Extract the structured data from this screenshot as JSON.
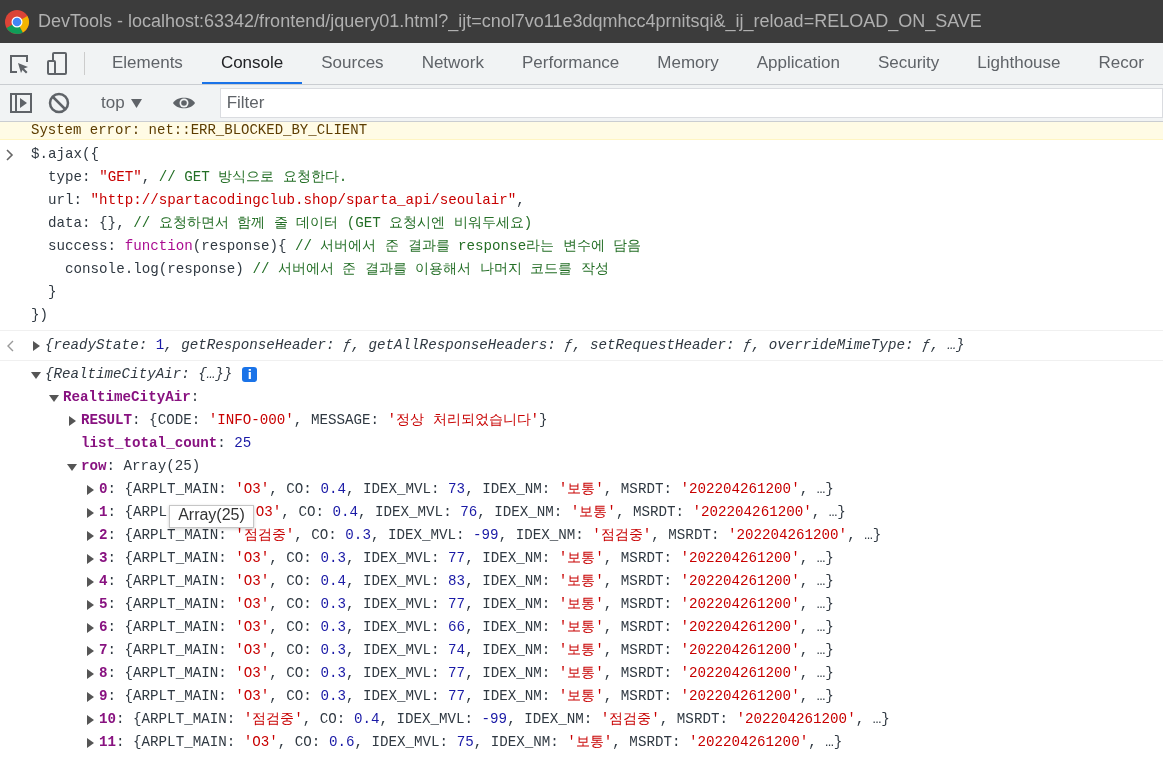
{
  "window": {
    "title": "DevTools - localhost:63342/frontend/jquery01.html?_ijt=cnol7vo11e3dqmhcc4prnitsqi&_ij_reload=RELOAD_ON_SAVE"
  },
  "tabs": [
    {
      "label": "Elements",
      "selected": false
    },
    {
      "label": "Console",
      "selected": true
    },
    {
      "label": "Sources",
      "selected": false
    },
    {
      "label": "Network",
      "selected": false
    },
    {
      "label": "Performance",
      "selected": false
    },
    {
      "label": "Memory",
      "selected": false
    },
    {
      "label": "Application",
      "selected": false
    },
    {
      "label": "Security",
      "selected": false
    },
    {
      "label": "Lighthouse",
      "selected": false
    },
    {
      "label": "Recor",
      "selected": false
    }
  ],
  "console_toolbar": {
    "context": "top",
    "filter": {
      "placeholder": "Filter"
    }
  },
  "error_line": "System error: net::ERR_BLOCKED_BY_CLIENT",
  "input": {
    "lines": [
      [
        {
          "text": "$.ajax({",
          "kind": "plain"
        }
      ],
      [
        {
          "text": "  type: ",
          "kind": "plain"
        },
        {
          "text": "\"GET\"",
          "kind": "string"
        },
        {
          "text": ", ",
          "kind": "plain"
        },
        {
          "text": "// GET 방식으로 요청한다.",
          "kind": "comment"
        }
      ],
      [
        {
          "text": "  url: ",
          "kind": "plain"
        },
        {
          "text": "\"http://spartacodingclub.shop/sparta_api/seoulair\"",
          "kind": "string"
        },
        {
          "text": ",",
          "kind": "plain"
        }
      ],
      [
        {
          "text": "  data: {}, ",
          "kind": "plain"
        },
        {
          "text": "// 요청하면서 함께 줄 데이터 (GET 요청시엔 비워두세요)",
          "kind": "comment"
        }
      ],
      [
        {
          "text": "  success: ",
          "kind": "plain"
        },
        {
          "text": "function",
          "kind": "keyword"
        },
        {
          "text": "(response){ ",
          "kind": "plain"
        },
        {
          "text": "// 서버에서 준 결과를 response라는 변수에 담음",
          "kind": "comment"
        }
      ],
      [
        {
          "text": "    console.log(response) ",
          "kind": "plain"
        },
        {
          "text": "// 서버에서 준 결과를 이용해서 나머지 코드를 작성",
          "kind": "comment"
        }
      ],
      [
        {
          "text": "  }",
          "kind": "plain"
        }
      ],
      [
        {
          "text": "})",
          "kind": "plain"
        }
      ]
    ]
  },
  "result": {
    "expanded": false,
    "tokens": [
      {
        "text": "{readyState: ",
        "kind": "preview"
      },
      {
        "text": "1",
        "kind": "number"
      },
      {
        "text": ", getResponseHeader: ƒ, getAllResponseHeaders: ƒ, setRequestHeader: ƒ, overrideMimeType: ƒ, …}",
        "kind": "preview"
      }
    ]
  },
  "tree": {
    "expanded": true,
    "info": "i",
    "tokens": [
      {
        "text": "{RealtimeCityAir: {…}}",
        "kind": "preview"
      }
    ],
    "children": [
      {
        "expanded": true,
        "tokens": [
          {
            "text": "RealtimeCityAir",
            "kind": "key"
          },
          {
            "text": ":",
            "kind": "plain"
          }
        ],
        "children": [
          {
            "expanded": false,
            "tokens": [
              {
                "text": "RESULT",
                "kind": "key"
              },
              {
                "text": ": {CODE: ",
                "kind": "plain"
              },
              {
                "text": "'INFO-000'",
                "kind": "string"
              },
              {
                "text": ", MESSAGE: ",
                "kind": "plain"
              },
              {
                "text": "'정상 처리되었습니다'",
                "kind": "string"
              },
              {
                "text": "}",
                "kind": "plain"
              }
            ]
          },
          {
            "tokens": [
              {
                "text": "list_total_count",
                "kind": "key"
              },
              {
                "text": ": ",
                "kind": "plain"
              },
              {
                "text": "25",
                "kind": "number"
              }
            ]
          },
          {
            "expanded": true,
            "tokens": [
              {
                "text": "row",
                "kind": "key"
              },
              {
                "text": ": Array(25)",
                "kind": "plain"
              }
            ],
            "children": [
              {
                "expanded": false,
                "tokens": [
                  {
                    "text": "0",
                    "kind": "key"
                  },
                  {
                    "text": ": {ARPLT_MAIN: ",
                    "kind": "plain"
                  },
                  {
                    "text": "'O3'",
                    "kind": "string"
                  },
                  {
                    "text": ", CO: ",
                    "kind": "plain"
                  },
                  {
                    "text": "0.4",
                    "kind": "number"
                  },
                  {
                    "text": ", IDEX_MVL: ",
                    "kind": "plain"
                  },
                  {
                    "text": "73",
                    "kind": "number"
                  },
                  {
                    "text": ", IDEX_NM: ",
                    "kind": "plain"
                  },
                  {
                    "text": "'보통'",
                    "kind": "string"
                  },
                  {
                    "text": ", MSRDT: ",
                    "kind": "plain"
                  },
                  {
                    "text": "'202204261200'",
                    "kind": "string"
                  },
                  {
                    "text": ", …}",
                    "kind": "plain"
                  }
                ]
              },
              {
                "expanded": false,
                "tokens": [
                  {
                    "text": "1",
                    "kind": "key"
                  },
                  {
                    "text": ": {ARPL",
                    "kind": "plain"
                  },
                  {
                    "text": "Array(25)",
                    "kind": "tooltip"
                  },
                  {
                    "text": "O3'",
                    "kind": "string"
                  },
                  {
                    "text": ", CO: ",
                    "kind": "plain"
                  },
                  {
                    "text": "0.4",
                    "kind": "number"
                  },
                  {
                    "text": ", IDEX_MVL: ",
                    "kind": "plain"
                  },
                  {
                    "text": "76",
                    "kind": "number"
                  },
                  {
                    "text": ", IDEX_NM: ",
                    "kind": "plain"
                  },
                  {
                    "text": "'보통'",
                    "kind": "string"
                  },
                  {
                    "text": ", MSRDT: ",
                    "kind": "plain"
                  },
                  {
                    "text": "'202204261200'",
                    "kind": "string"
                  },
                  {
                    "text": ", …}",
                    "kind": "plain"
                  }
                ]
              },
              {
                "expanded": false,
                "tokens": [
                  {
                    "text": "2",
                    "kind": "key"
                  },
                  {
                    "text": ": {ARPLT_MAIN: ",
                    "kind": "plain"
                  },
                  {
                    "text": "'점검중'",
                    "kind": "string"
                  },
                  {
                    "text": ", CO: ",
                    "kind": "plain"
                  },
                  {
                    "text": "0.3",
                    "kind": "number"
                  },
                  {
                    "text": ", IDEX_MVL: ",
                    "kind": "plain"
                  },
                  {
                    "text": "-99",
                    "kind": "number"
                  },
                  {
                    "text": ", IDEX_NM: ",
                    "kind": "plain"
                  },
                  {
                    "text": "'점검중'",
                    "kind": "string"
                  },
                  {
                    "text": ", MSRDT: ",
                    "kind": "plain"
                  },
                  {
                    "text": "'202204261200'",
                    "kind": "string"
                  },
                  {
                    "text": ", …}",
                    "kind": "plain"
                  }
                ]
              },
              {
                "expanded": false,
                "tokens": [
                  {
                    "text": "3",
                    "kind": "key"
                  },
                  {
                    "text": ": {ARPLT_MAIN: ",
                    "kind": "plain"
                  },
                  {
                    "text": "'O3'",
                    "kind": "string"
                  },
                  {
                    "text": ", CO: ",
                    "kind": "plain"
                  },
                  {
                    "text": "0.3",
                    "kind": "number"
                  },
                  {
                    "text": ", IDEX_MVL: ",
                    "kind": "plain"
                  },
                  {
                    "text": "77",
                    "kind": "number"
                  },
                  {
                    "text": ", IDEX_NM: ",
                    "kind": "plain"
                  },
                  {
                    "text": "'보통'",
                    "kind": "string"
                  },
                  {
                    "text": ", MSRDT: ",
                    "kind": "plain"
                  },
                  {
                    "text": "'202204261200'",
                    "kind": "string"
                  },
                  {
                    "text": ", …}",
                    "kind": "plain"
                  }
                ]
              },
              {
                "expanded": false,
                "tokens": [
                  {
                    "text": "4",
                    "kind": "key"
                  },
                  {
                    "text": ": {ARPLT_MAIN: ",
                    "kind": "plain"
                  },
                  {
                    "text": "'O3'",
                    "kind": "string"
                  },
                  {
                    "text": ", CO: ",
                    "kind": "plain"
                  },
                  {
                    "text": "0.4",
                    "kind": "number"
                  },
                  {
                    "text": ", IDEX_MVL: ",
                    "kind": "plain"
                  },
                  {
                    "text": "83",
                    "kind": "number"
                  },
                  {
                    "text": ", IDEX_NM: ",
                    "kind": "plain"
                  },
                  {
                    "text": "'보통'",
                    "kind": "string"
                  },
                  {
                    "text": ", MSRDT: ",
                    "kind": "plain"
                  },
                  {
                    "text": "'202204261200'",
                    "kind": "string"
                  },
                  {
                    "text": ", …}",
                    "kind": "plain"
                  }
                ]
              },
              {
                "expanded": false,
                "tokens": [
                  {
                    "text": "5",
                    "kind": "key"
                  },
                  {
                    "text": ": {ARPLT_MAIN: ",
                    "kind": "plain"
                  },
                  {
                    "text": "'O3'",
                    "kind": "string"
                  },
                  {
                    "text": ", CO: ",
                    "kind": "plain"
                  },
                  {
                    "text": "0.3",
                    "kind": "number"
                  },
                  {
                    "text": ", IDEX_MVL: ",
                    "kind": "plain"
                  },
                  {
                    "text": "77",
                    "kind": "number"
                  },
                  {
                    "text": ", IDEX_NM: ",
                    "kind": "plain"
                  },
                  {
                    "text": "'보통'",
                    "kind": "string"
                  },
                  {
                    "text": ", MSRDT: ",
                    "kind": "plain"
                  },
                  {
                    "text": "'202204261200'",
                    "kind": "string"
                  },
                  {
                    "text": ", …}",
                    "kind": "plain"
                  }
                ]
              },
              {
                "expanded": false,
                "tokens": [
                  {
                    "text": "6",
                    "kind": "key"
                  },
                  {
                    "text": ": {ARPLT_MAIN: ",
                    "kind": "plain"
                  },
                  {
                    "text": "'O3'",
                    "kind": "string"
                  },
                  {
                    "text": ", CO: ",
                    "kind": "plain"
                  },
                  {
                    "text": "0.3",
                    "kind": "number"
                  },
                  {
                    "text": ", IDEX_MVL: ",
                    "kind": "plain"
                  },
                  {
                    "text": "66",
                    "kind": "number"
                  },
                  {
                    "text": ", IDEX_NM: ",
                    "kind": "plain"
                  },
                  {
                    "text": "'보통'",
                    "kind": "string"
                  },
                  {
                    "text": ", MSRDT: ",
                    "kind": "plain"
                  },
                  {
                    "text": "'202204261200'",
                    "kind": "string"
                  },
                  {
                    "text": ", …}",
                    "kind": "plain"
                  }
                ]
              },
              {
                "expanded": false,
                "tokens": [
                  {
                    "text": "7",
                    "kind": "key"
                  },
                  {
                    "text": ": {ARPLT_MAIN: ",
                    "kind": "plain"
                  },
                  {
                    "text": "'O3'",
                    "kind": "string"
                  },
                  {
                    "text": ", CO: ",
                    "kind": "plain"
                  },
                  {
                    "text": "0.3",
                    "kind": "number"
                  },
                  {
                    "text": ", IDEX_MVL: ",
                    "kind": "plain"
                  },
                  {
                    "text": "74",
                    "kind": "number"
                  },
                  {
                    "text": ", IDEX_NM: ",
                    "kind": "plain"
                  },
                  {
                    "text": "'보통'",
                    "kind": "string"
                  },
                  {
                    "text": ", MSRDT: ",
                    "kind": "plain"
                  },
                  {
                    "text": "'202204261200'",
                    "kind": "string"
                  },
                  {
                    "text": ", …}",
                    "kind": "plain"
                  }
                ]
              },
              {
                "expanded": false,
                "tokens": [
                  {
                    "text": "8",
                    "kind": "key"
                  },
                  {
                    "text": ": {ARPLT_MAIN: ",
                    "kind": "plain"
                  },
                  {
                    "text": "'O3'",
                    "kind": "string"
                  },
                  {
                    "text": ", CO: ",
                    "kind": "plain"
                  },
                  {
                    "text": "0.3",
                    "kind": "number"
                  },
                  {
                    "text": ", IDEX_MVL: ",
                    "kind": "plain"
                  },
                  {
                    "text": "77",
                    "kind": "number"
                  },
                  {
                    "text": ", IDEX_NM: ",
                    "kind": "plain"
                  },
                  {
                    "text": "'보통'",
                    "kind": "string"
                  },
                  {
                    "text": ", MSRDT: ",
                    "kind": "plain"
                  },
                  {
                    "text": "'202204261200'",
                    "kind": "string"
                  },
                  {
                    "text": ", …}",
                    "kind": "plain"
                  }
                ]
              },
              {
                "expanded": false,
                "tokens": [
                  {
                    "text": "9",
                    "kind": "key"
                  },
                  {
                    "text": ": {ARPLT_MAIN: ",
                    "kind": "plain"
                  },
                  {
                    "text": "'O3'",
                    "kind": "string"
                  },
                  {
                    "text": ", CO: ",
                    "kind": "plain"
                  },
                  {
                    "text": "0.3",
                    "kind": "number"
                  },
                  {
                    "text": ", IDEX_MVL: ",
                    "kind": "plain"
                  },
                  {
                    "text": "77",
                    "kind": "number"
                  },
                  {
                    "text": ", IDEX_NM: ",
                    "kind": "plain"
                  },
                  {
                    "text": "'보통'",
                    "kind": "string"
                  },
                  {
                    "text": ", MSRDT: ",
                    "kind": "plain"
                  },
                  {
                    "text": "'202204261200'",
                    "kind": "string"
                  },
                  {
                    "text": ", …}",
                    "kind": "plain"
                  }
                ]
              },
              {
                "expanded": false,
                "tokens": [
                  {
                    "text": "10",
                    "kind": "key"
                  },
                  {
                    "text": ": {ARPLT_MAIN: ",
                    "kind": "plain"
                  },
                  {
                    "text": "'점검중'",
                    "kind": "string"
                  },
                  {
                    "text": ", CO: ",
                    "kind": "plain"
                  },
                  {
                    "text": "0.4",
                    "kind": "number"
                  },
                  {
                    "text": ", IDEX_MVL: ",
                    "kind": "plain"
                  },
                  {
                    "text": "-99",
                    "kind": "number"
                  },
                  {
                    "text": ", IDEX_NM: ",
                    "kind": "plain"
                  },
                  {
                    "text": "'점검중'",
                    "kind": "string"
                  },
                  {
                    "text": ", MSRDT: ",
                    "kind": "plain"
                  },
                  {
                    "text": "'202204261200'",
                    "kind": "string"
                  },
                  {
                    "text": ", …}",
                    "kind": "plain"
                  }
                ]
              },
              {
                "expanded": false,
                "tokens": [
                  {
                    "text": "11",
                    "kind": "key"
                  },
                  {
                    "text": ": {ARPLT_MAIN: ",
                    "kind": "plain"
                  },
                  {
                    "text": "'O3'",
                    "kind": "string"
                  },
                  {
                    "text": ", CO: ",
                    "kind": "plain"
                  },
                  {
                    "text": "0.6",
                    "kind": "number"
                  },
                  {
                    "text": ", IDEX_MVL: ",
                    "kind": "plain"
                  },
                  {
                    "text": "75",
                    "kind": "number"
                  },
                  {
                    "text": ", IDEX_NM: ",
                    "kind": "plain"
                  },
                  {
                    "text": "'보통'",
                    "kind": "string"
                  },
                  {
                    "text": ", MSRDT: ",
                    "kind": "plain"
                  },
                  {
                    "text": "'202204261200'",
                    "kind": "string"
                  },
                  {
                    "text": ", …}",
                    "kind": "plain"
                  }
                ]
              }
            ]
          }
        ]
      }
    ]
  }
}
